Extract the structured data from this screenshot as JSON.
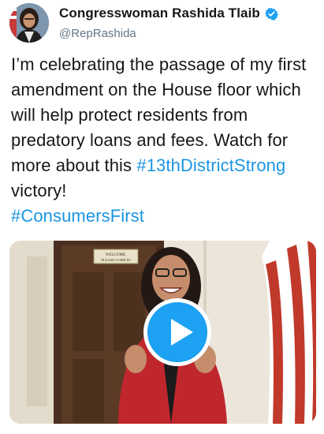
{
  "author": {
    "display_name": "Congresswoman Rashida Tlaib",
    "handle": "@RepRashida",
    "verified": true
  },
  "tweet": {
    "text_segments": [
      {
        "type": "text",
        "value": "I’m celebrating the passage of my first amendment on the House floor which will help protect residents from predatory loans and fees. Watch for more about this "
      },
      {
        "type": "hashtag",
        "value": "#13thDistrictStrong"
      },
      {
        "type": "text",
        "value": " victory!"
      },
      {
        "type": "break",
        "value": ""
      },
      {
        "type": "hashtag",
        "value": "#ConsumersFirst"
      }
    ]
  },
  "media": {
    "type": "video",
    "door_sign": [
      "WELCOME,",
      "PLEASE COME IN"
    ],
    "play_icon": "play-icon"
  },
  "colors": {
    "hashtag": "#1b95e0",
    "play_button": "#1da1f2",
    "verified_badge": "#1da1f2",
    "handle": "#657786"
  }
}
